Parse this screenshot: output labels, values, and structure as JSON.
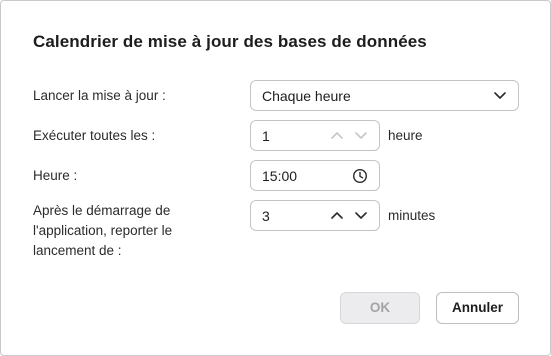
{
  "dialog": {
    "title": "Calendrier de mise à jour des bases de données"
  },
  "fields": {
    "run_update": {
      "label": "Lancer la mise à jour :",
      "value": "Chaque heure"
    },
    "interval": {
      "label": "Exécuter toutes les :",
      "value": "1",
      "unit": "heure"
    },
    "time": {
      "label": "Heure :",
      "value": "15:00"
    },
    "delay": {
      "label_line1": "Après le démarrage de",
      "label_line2": "l'application, reporter le",
      "label_line3": "lancement de :",
      "value": "3",
      "unit": "minutes"
    }
  },
  "buttons": {
    "ok": "OK",
    "cancel": "Annuler"
  },
  "icons": {
    "dropdown": "chevron-down-icon",
    "stepper_up": "chevron-up-icon",
    "stepper_down": "chevron-down-icon",
    "clock": "clock-icon"
  },
  "colors": {
    "text": "#1d1d1f",
    "border": "#c4c4c8",
    "disabled_button_bg": "#ececee",
    "disabled_button_text": "#a3a3a8"
  }
}
